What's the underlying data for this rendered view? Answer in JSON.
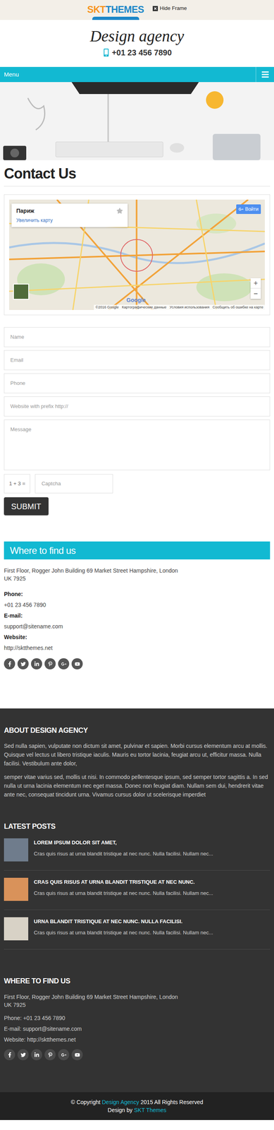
{
  "topbar": {
    "logo": {
      "part1": "SKT",
      "part2": "THEMES"
    },
    "hide_frame": "Hide Frame"
  },
  "header": {
    "site_title": "Design agency",
    "phone": "+01 23 456 7890"
  },
  "nav": {
    "menu_label": "Menu"
  },
  "page": {
    "title": "Contact Us"
  },
  "map": {
    "place": "Париж",
    "enlarge": "Увеличить карту",
    "login": "Войти",
    "zoom_in": "+",
    "zoom_out": "−",
    "google": "Google",
    "attribution": [
      "©2016 Google",
      "Картографические данные",
      "Условия использования",
      "Сообщить об ошибке на карте"
    ]
  },
  "form": {
    "fields": [
      {
        "placeholder": "Name",
        "kind": "input"
      },
      {
        "placeholder": "Email",
        "kind": "input"
      },
      {
        "placeholder": "Phone",
        "kind": "input"
      },
      {
        "placeholder": "Website with prefix http://",
        "kind": "input"
      },
      {
        "placeholder": "Message",
        "kind": "textarea"
      }
    ],
    "captcha_question": "1 + 3 =",
    "captcha_placeholder": "Captcha",
    "submit": "SUBMIT"
  },
  "contact": {
    "heading": "Where to find us",
    "address": [
      "First Floor, Rogger John Building 69 Market Street Hampshire, London",
      "UK 7925"
    ],
    "items": [
      {
        "label": "Phone:",
        "value": "+01 23 456 7890"
      },
      {
        "label": "E-mail:",
        "value": "support@sitename.com"
      },
      {
        "label": "Website:",
        "value": "http://sktthemes.net"
      }
    ]
  },
  "footer": {
    "about": {
      "heading": "ABOUT DESIGN AGENCY",
      "paragraphs": [
        "Sed nulla sapien, vulputate non dictum sit amet, pulvinar et sapien. Morbi cursus elementum arcu at mollis. Quisque vel lectus ut libero tristique iaculis. Mauris eu tortor lacinia, feugiat arcu ut, efficitur massa. Nulla facilisi. Vestibulum ante dolor,",
        "semper vitae varius sed, mollis ut nisi. In commodo pellentesque ipsum, sed semper tortor sagittis a. In sed nulla ut urna lacinia elementum nec eget massa. Donec non feugiat diam. Nullam sem dui, hendrerit vitae ante nec, consequat tincidunt urna. Vivamus cursus dolor ut scelerisque imperdiet"
      ]
    },
    "latest": {
      "heading": "LATEST POSTS",
      "posts": [
        {
          "title": "LOREM IPSUM DOLOR SIT AMET,",
          "excerpt": "Cras quis risus at urna blandit tristique at nec nunc. Nulla facilisi. Nullam nec..."
        },
        {
          "title": "CRAS QUIS RISUS AT URNA BLANDIT TRISTIQUE AT NEC NUNC.",
          "excerpt": "Cras quis risus at urna blandit tristique at nec nunc. Nulla facilisi. Nullam nec..."
        },
        {
          "title": "URNA BLANDIT TRISTIQUE AT NEC NUNC. NULLA FACILISI.",
          "excerpt": "Cras quis risus at urna blandit tristique at nec nunc. Nulla facilisi. Nullam nec..."
        }
      ]
    },
    "find": {
      "heading": "WHERE TO FIND US",
      "address": [
        "First Floor, Rogger John Building 69 Market Street Hampshire, London",
        "UK 7925"
      ],
      "items": [
        {
          "label": "Phone:",
          "value": "+01 23 456 7890"
        },
        {
          "label": "E-mail:",
          "value": "support@sitename.com"
        },
        {
          "label": "Website:",
          "value": "http://sktthemes.net"
        }
      ]
    }
  },
  "copyright": {
    "prefix": "© Copyright",
    "link": "Design Agency",
    "suffix": "2015 All Rights Reserved"
  },
  "credit": {
    "prefix": "Design by",
    "link": "SKT Themes"
  }
}
